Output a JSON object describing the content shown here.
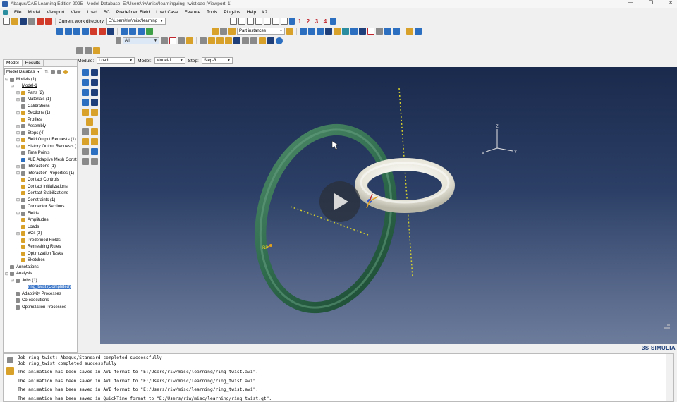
{
  "window": {
    "title": "Abaqus/CAE Learning Edition 2025 - Model Database: E:\\Users\\riw\\misc\\learning\\ring_twist.cae [Viewport: 1]",
    "controls": [
      "—",
      "❐",
      "✕"
    ]
  },
  "menu": [
    "File",
    "Model",
    "Viewport",
    "View",
    "Load",
    "BC",
    "Predefined Field",
    "Load Case",
    "Feature",
    "Tools",
    "Plug-ins",
    "Help",
    "k?"
  ],
  "toolbar": {
    "work_dir_label": "Current work directory:",
    "work_dir_value": "E:\\Users\\riw\\misc\\learning",
    "view_numbers": [
      "1",
      "2",
      "3",
      "4"
    ],
    "instances_combo": "Part instances",
    "selection_combo": "All"
  },
  "context": {
    "module_label": "Module:",
    "module_value": "Load",
    "model_label": "Model:",
    "model_value": "Model-1",
    "step_label": "Step:",
    "step_value": "Step-3"
  },
  "left_panel": {
    "tabs": [
      "Model",
      "Results"
    ],
    "db_combo": "Model Database",
    "tree": [
      {
        "indent": 0,
        "exp": "⊟",
        "icon": "gray",
        "label": "Models (1)"
      },
      {
        "indent": 1,
        "exp": "⊟",
        "icon": "none",
        "label": "Model-1",
        "underline": true
      },
      {
        "indent": 2,
        "exp": "⊞",
        "icon": "gold",
        "label": "Parts (2)"
      },
      {
        "indent": 2,
        "exp": "⊞",
        "icon": "gray",
        "label": "Materials (1)"
      },
      {
        "indent": 2,
        "exp": "",
        "icon": "gray",
        "label": "Calibrations"
      },
      {
        "indent": 2,
        "exp": "⊞",
        "icon": "gold",
        "label": "Sections (1)"
      },
      {
        "indent": 2,
        "exp": "",
        "icon": "gold",
        "label": "Profiles"
      },
      {
        "indent": 2,
        "exp": "⊞",
        "icon": "gray",
        "label": "Assembly"
      },
      {
        "indent": 2,
        "exp": "⊞",
        "icon": "gray",
        "label": "Steps (4)"
      },
      {
        "indent": 2,
        "exp": "⊞",
        "icon": "gold",
        "label": "Field Output Requests (1)"
      },
      {
        "indent": 2,
        "exp": "⊞",
        "icon": "gold",
        "label": "History Output Requests (1)"
      },
      {
        "indent": 2,
        "exp": "",
        "icon": "gray",
        "label": "Time Points"
      },
      {
        "indent": 2,
        "exp": "",
        "icon": "blue",
        "label": "ALE Adaptive Mesh Constraints"
      },
      {
        "indent": 2,
        "exp": "⊞",
        "icon": "gray",
        "label": "Interactions (1)"
      },
      {
        "indent": 2,
        "exp": "⊞",
        "icon": "gray",
        "label": "Interaction Properties (1)"
      },
      {
        "indent": 2,
        "exp": "",
        "icon": "gold",
        "label": "Contact Controls"
      },
      {
        "indent": 2,
        "exp": "",
        "icon": "gold",
        "label": "Contact Initializations"
      },
      {
        "indent": 2,
        "exp": "",
        "icon": "gold",
        "label": "Contact Stabilizations"
      },
      {
        "indent": 2,
        "exp": "⊞",
        "icon": "gray",
        "label": "Constraints (1)"
      },
      {
        "indent": 2,
        "exp": "",
        "icon": "gray",
        "label": "Connector Sections"
      },
      {
        "indent": 2,
        "exp": "⊞",
        "icon": "gray",
        "label": "Fields"
      },
      {
        "indent": 2,
        "exp": "",
        "icon": "gold",
        "label": "Amplitudes"
      },
      {
        "indent": 2,
        "exp": "",
        "icon": "gold",
        "label": "Loads"
      },
      {
        "indent": 2,
        "exp": "⊞",
        "icon": "gold",
        "label": "BCs (2)"
      },
      {
        "indent": 2,
        "exp": "",
        "icon": "gold",
        "label": "Predefined Fields"
      },
      {
        "indent": 2,
        "exp": "",
        "icon": "gold",
        "label": "Remeshing Rules"
      },
      {
        "indent": 2,
        "exp": "",
        "icon": "gold",
        "label": "Optimization Tasks"
      },
      {
        "indent": 2,
        "exp": "",
        "icon": "gold",
        "label": "Sketches"
      },
      {
        "indent": 0,
        "exp": "",
        "icon": "gray",
        "label": "Annotations"
      },
      {
        "indent": 0,
        "exp": "⊟",
        "icon": "gray",
        "label": "Analysis"
      },
      {
        "indent": 1,
        "exp": "⊟",
        "icon": "gray",
        "label": "Jobs (1)"
      },
      {
        "indent": 2,
        "exp": "",
        "icon": "none",
        "label": "ring_twist (Completed)",
        "selected": true
      },
      {
        "indent": 1,
        "exp": "",
        "icon": "gray",
        "label": "Adaptivity Processes"
      },
      {
        "indent": 1,
        "exp": "",
        "icon": "gray",
        "label": "Co-executions"
      },
      {
        "indent": 1,
        "exp": "",
        "icon": "gray",
        "label": "Optimization Processes"
      }
    ]
  },
  "viewport": {
    "triad": {
      "z": "Z",
      "x": "X",
      "y": "Y"
    },
    "rp_label": "RP",
    "colors": {
      "ring_large": "#2f6b4d",
      "ring_small": "#e8e6da",
      "axis": "#d6d12c",
      "bg_top": "#1a2a4d",
      "bg_bottom": "#6d7c9b"
    }
  },
  "brand": "3S SIMULIA",
  "messages": [
    "Job ring_twist: Abaqus/Standard completed successfully",
    "Job ring_twist completed successfully",
    "The animation has been saved in AVI format to \"E:/Users/riw/misc/learning/ring_twist.avi\".",
    "The animation has been saved in AVI format to \"E:/Users/riw/misc/learning/ring_twist.avi\".",
    "The animation has been saved in AVI format to \"E:/Users/riw/misc/learning/ring_twist.avi\".",
    "The animation has been saved in QuickTime format to \"E:/Users/riw/misc/learning/ring_twist.qt\"."
  ]
}
